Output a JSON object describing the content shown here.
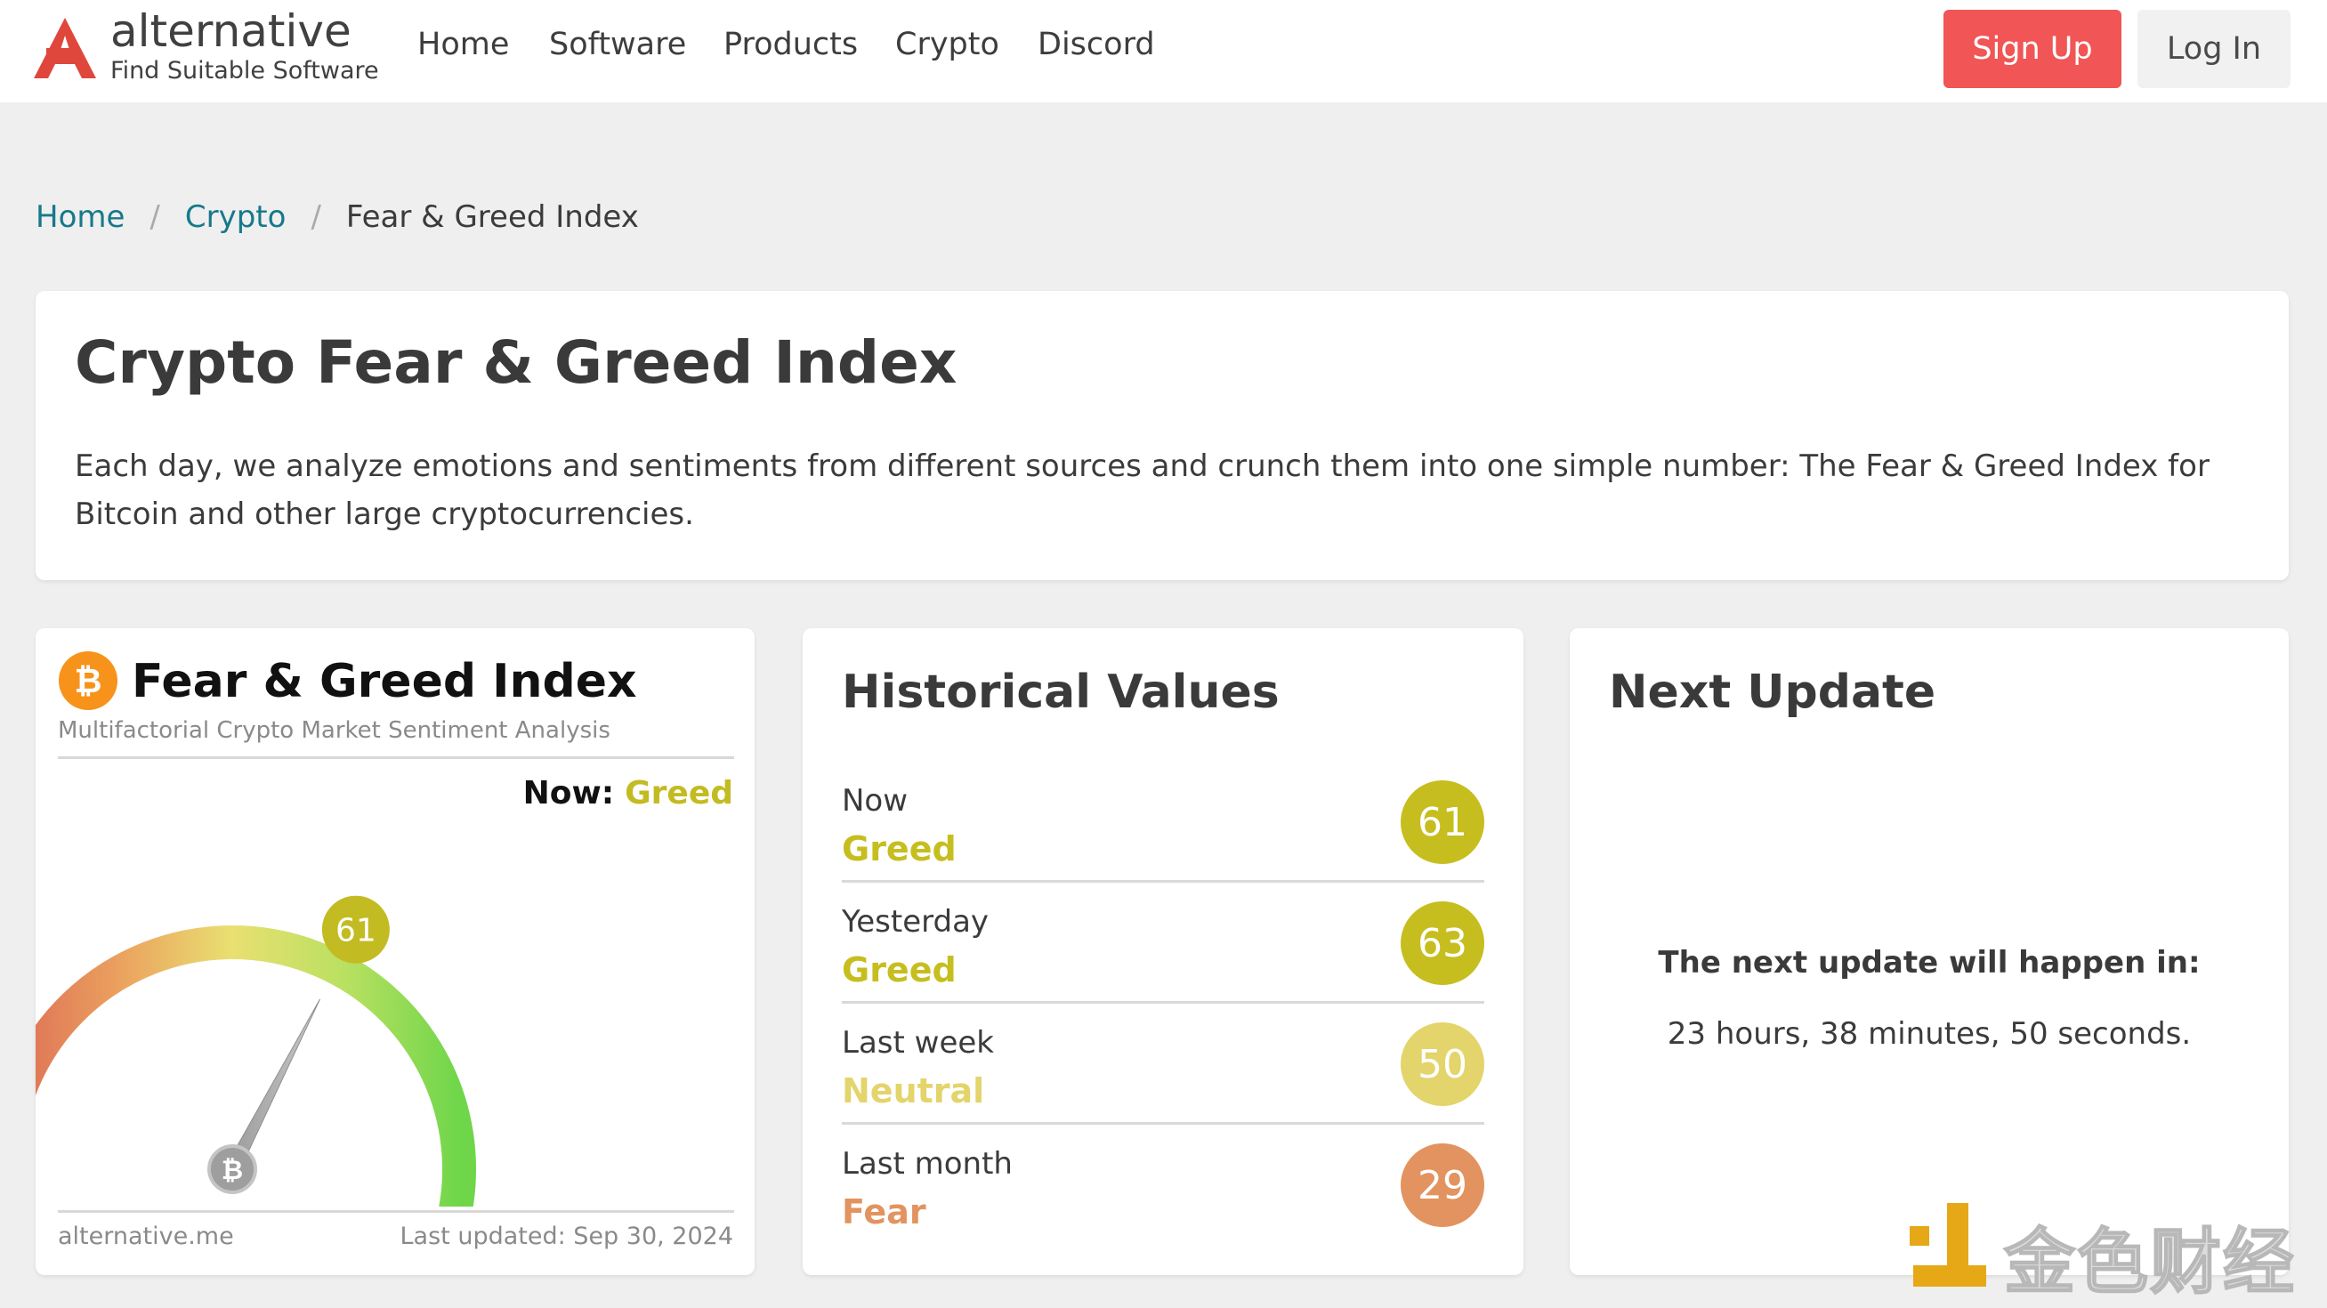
{
  "header": {
    "logo_name": "alternative",
    "logo_tagline": "Find Suitable Software",
    "nav": [
      "Home",
      "Software",
      "Products",
      "Crypto",
      "Discord"
    ],
    "signup_label": "Sign Up",
    "login_label": "Log In"
  },
  "breadcrumb": [
    "Home",
    "Crypto",
    "Fear & Greed Index"
  ],
  "hero": {
    "title": "Crypto Fear & Greed Index",
    "description": "Each day, we analyze emotions and sentiments from different sources and crunch them into one simple number: The Fear & Greed Index for Bitcoin and other large cryptocurrencies."
  },
  "gauge_card": {
    "title": "Fear & Greed Index",
    "subtitle": "Multifactorial Crypto Market Sentiment Analysis",
    "now_label": "Now:",
    "now_class": "Greed",
    "value": 61,
    "scale_min": 0,
    "scale_max": 100,
    "site": "alternative.me",
    "last_updated": "Last updated: Sep 30, 2024"
  },
  "historical": {
    "title": "Historical Values",
    "rows": [
      {
        "label": "Now",
        "classification": "Greed",
        "value": "61",
        "color": "#c6be1f"
      },
      {
        "label": "Yesterday",
        "classification": "Greed",
        "value": "63",
        "color": "#c6be1f"
      },
      {
        "label": "Last week",
        "classification": "Neutral",
        "value": "50",
        "color": "#e3d46b"
      },
      {
        "label": "Last month",
        "classification": "Fear",
        "value": "29",
        "color": "#e2935f"
      }
    ]
  },
  "next_update": {
    "title": "Next Update",
    "heading": "The next update will happen in:",
    "time": "23 hours, 38 minutes, 50 seconds."
  },
  "watermark": {
    "text": "金色财经"
  },
  "colors": {
    "brand_red": "#e0473c",
    "signup": "#f15555",
    "link": "#16798a",
    "greed": "#c3bb22",
    "neutral": "#e3d46b",
    "fear": "#e2935f",
    "btc_orange": "#f7931a"
  }
}
